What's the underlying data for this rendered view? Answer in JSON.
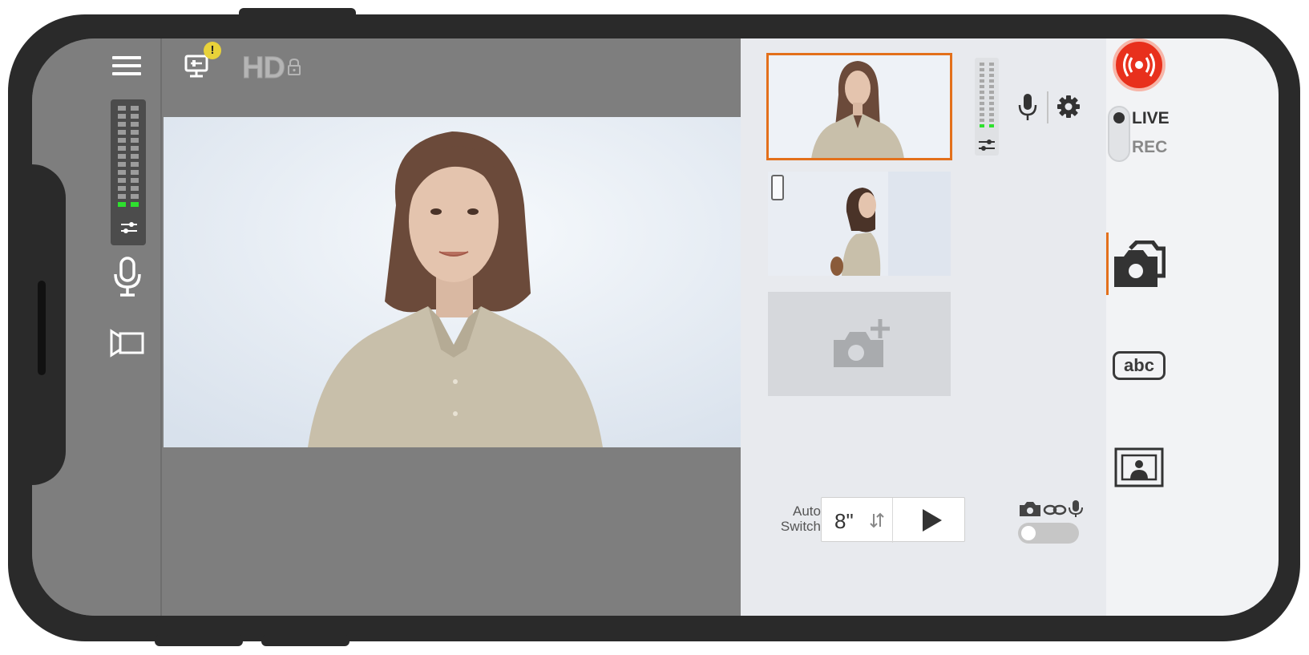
{
  "topbar": {
    "warning_mark": "!",
    "quality": "HD"
  },
  "sources": {
    "add_source_icon": "camera-plus-icon"
  },
  "auto_switch": {
    "label_line1": "Auto",
    "label_line2": "Switch",
    "interval": "8\""
  },
  "broadcast": {
    "live_label": "LIVE",
    "rec_label": "REC",
    "mode": "LIVE"
  },
  "tabs": {
    "text_tab": "abc"
  },
  "colors": {
    "accent": "#e3701b",
    "live_red": "#e8301c",
    "meter_green": "#2ee02e"
  }
}
